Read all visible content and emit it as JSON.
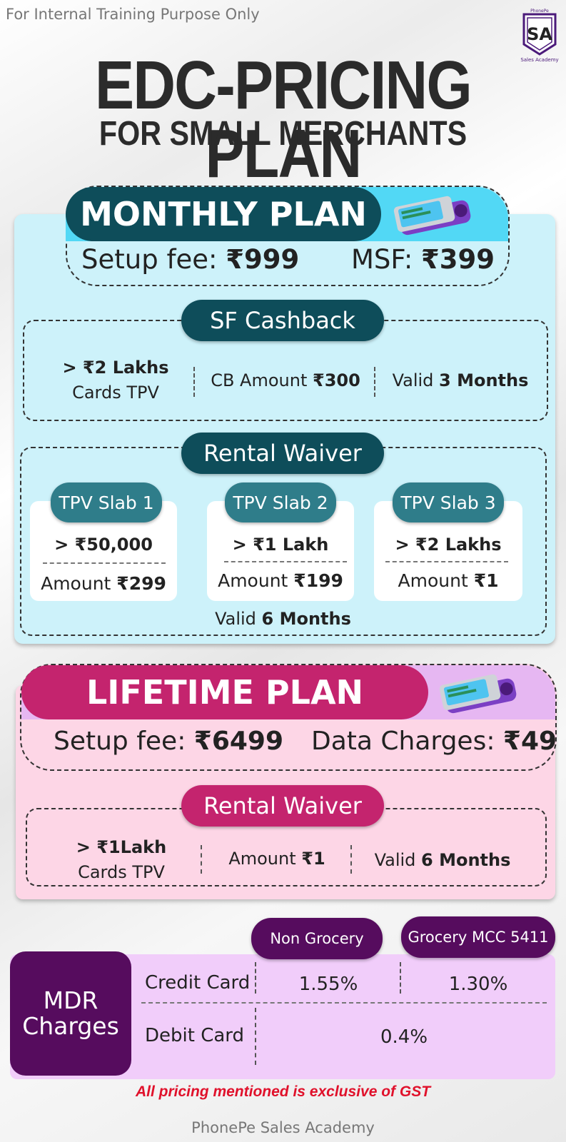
{
  "top_note": "For Internal Training Purpose Only",
  "logo": {
    "brand": "PhonePe",
    "mark": "SA",
    "caption": "Sales Academy",
    "icon": "sales-academy-shield-icon"
  },
  "title": "EDC-PRICING PLAN",
  "subtitle": "FOR SMALL MERCHANTS",
  "monthly": {
    "heading": "MONTHLY PLAN",
    "setup_label": "Setup fee: ",
    "setup_value": "₹999",
    "msf_label": "MSF: ",
    "msf_value": "₹399",
    "cashback": {
      "heading": "SF Cashback",
      "tpv_bold": "> ₹2 Lakhs",
      "tpv_sub": "Cards TPV",
      "cb_label": "CB Amount ",
      "cb_value": "₹300",
      "valid_label": "Valid ",
      "valid_value": "3 Months"
    },
    "rental": {
      "heading": "Rental Waiver",
      "slabs": [
        {
          "name": "TPV Slab 1",
          "threshold": "> ₹50,000",
          "amount_label": "Amount ",
          "amount_value": "₹299"
        },
        {
          "name": "TPV Slab 2",
          "threshold": "> ₹1 Lakh",
          "amount_label": "Amount ",
          "amount_value": "₹199"
        },
        {
          "name": "TPV Slab 3",
          "threshold": "> ₹2 Lakhs",
          "amount_label": "Amount ",
          "amount_value": "₹1"
        }
      ],
      "valid_label": "Valid ",
      "valid_value": "6 Months"
    }
  },
  "lifetime": {
    "heading": "LIFETIME PLAN",
    "setup_label": "Setup fee: ",
    "setup_value": "₹6499",
    "data_label": "Data Charges: ",
    "data_value": "₹49",
    "rental": {
      "heading": "Rental Waiver",
      "tpv_bold": "> ₹1Lakh",
      "tpv_sub": "Cards TPV",
      "amount_label": "Amount ",
      "amount_value": "₹1",
      "valid_label": "Valid ",
      "valid_value": "6 Months"
    }
  },
  "mdr": {
    "label_line1": "MDR",
    "label_line2": "Charges",
    "col1": "Non Grocery",
    "col2": "Grocery MCC 5411",
    "rows": [
      {
        "name": "Credit Card",
        "non_grocery": "1.55%",
        "grocery": "1.30%"
      },
      {
        "name": "Debit Card",
        "all": "0.4%"
      }
    ]
  },
  "gst_note": "All pricing mentioned is exclusive of GST",
  "footer": "PhonePe Sales Academy",
  "colors": {
    "teal": "#0e4d5a",
    "cyan_panel": "#cdf2fa",
    "magenta": "#c4246e",
    "pink_panel": "#fdd6e6",
    "purple": "#560c5e",
    "lilac": "#f1cdfa",
    "gst_red": "#e0112b"
  }
}
